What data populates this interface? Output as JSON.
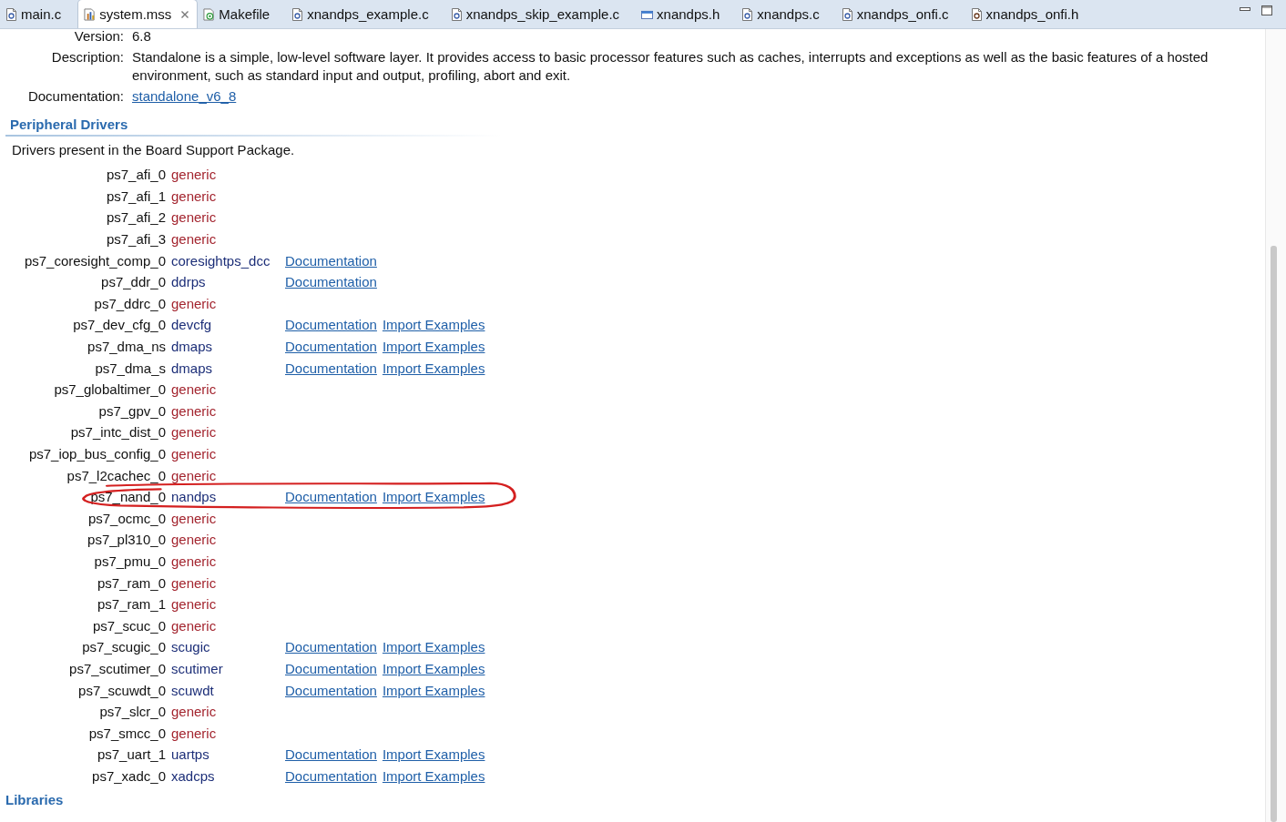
{
  "tabs": [
    {
      "label": "main.c",
      "kind": "c",
      "selected": false,
      "closable": false
    },
    {
      "label": "system.mss",
      "kind": "mss",
      "selected": true,
      "closable": true
    },
    {
      "label": "Makefile",
      "kind": "make",
      "selected": false,
      "closable": false
    },
    {
      "label": "xnandps_example.c",
      "kind": "c",
      "selected": false,
      "closable": false
    },
    {
      "label": "xnandps_skip_example.c",
      "kind": "c",
      "selected": false,
      "closable": false
    },
    {
      "label": "xnandps.h",
      "kind": "window",
      "selected": false,
      "closable": false
    },
    {
      "label": "xnandps.c",
      "kind": "c",
      "selected": false,
      "closable": false
    },
    {
      "label": "xnandps_onfi.c",
      "kind": "c",
      "selected": false,
      "closable": false
    },
    {
      "label": "xnandps_onfi.h",
      "kind": "h",
      "selected": false,
      "closable": false
    }
  ],
  "os_info": [
    {
      "label": "Version:",
      "value": "6.8",
      "kind": "text"
    },
    {
      "label": "Description:",
      "value": "Standalone is a simple, low-level software layer. It provides access to basic processor features such as caches, interrupts and exceptions as well as the basic features of a hosted environment, such as standard input and output, profiling, abort and exit.",
      "kind": "text"
    },
    {
      "label": "Documentation:",
      "value": "standalone_v6_8",
      "kind": "link"
    }
  ],
  "peripheral_drivers": {
    "title": "Peripheral Drivers",
    "description": "Drivers present in the Board Support Package.",
    "rows": [
      {
        "instance": "ps7_afi_0",
        "driver": "generic",
        "kind": "generic",
        "links": [],
        "highlighted": false
      },
      {
        "instance": "ps7_afi_1",
        "driver": "generic",
        "kind": "generic",
        "links": [],
        "highlighted": false
      },
      {
        "instance": "ps7_afi_2",
        "driver": "generic",
        "kind": "generic",
        "links": [],
        "highlighted": false
      },
      {
        "instance": "ps7_afi_3",
        "driver": "generic",
        "kind": "generic",
        "links": [],
        "highlighted": false
      },
      {
        "instance": "ps7_coresight_comp_0",
        "driver": "coresightps_dcc",
        "kind": "driver",
        "links": [
          "Documentation"
        ],
        "highlighted": false
      },
      {
        "instance": "ps7_ddr_0",
        "driver": "ddrps",
        "kind": "driver",
        "links": [
          "Documentation"
        ],
        "highlighted": false
      },
      {
        "instance": "ps7_ddrc_0",
        "driver": "generic",
        "kind": "generic",
        "links": [],
        "highlighted": false
      },
      {
        "instance": "ps7_dev_cfg_0",
        "driver": "devcfg",
        "kind": "driver",
        "links": [
          "Documentation",
          "Import Examples"
        ],
        "highlighted": false
      },
      {
        "instance": "ps7_dma_ns",
        "driver": "dmaps",
        "kind": "driver",
        "links": [
          "Documentation",
          "Import Examples"
        ],
        "highlighted": false
      },
      {
        "instance": "ps7_dma_s",
        "driver": "dmaps",
        "kind": "driver",
        "links": [
          "Documentation",
          "Import Examples"
        ],
        "highlighted": false
      },
      {
        "instance": "ps7_globaltimer_0",
        "driver": "generic",
        "kind": "generic",
        "links": [],
        "highlighted": false
      },
      {
        "instance": "ps7_gpv_0",
        "driver": "generic",
        "kind": "generic",
        "links": [],
        "highlighted": false
      },
      {
        "instance": "ps7_intc_dist_0",
        "driver": "generic",
        "kind": "generic",
        "links": [],
        "highlighted": false
      },
      {
        "instance": "ps7_iop_bus_config_0",
        "driver": "generic",
        "kind": "generic",
        "links": [],
        "highlighted": false
      },
      {
        "instance": "ps7_l2cachec_0",
        "driver": "generic",
        "kind": "generic",
        "links": [],
        "highlighted": false
      },
      {
        "instance": "ps7_nand_0",
        "driver": "nandps",
        "kind": "driver",
        "links": [
          "Documentation",
          "Import Examples"
        ],
        "highlighted": true
      },
      {
        "instance": "ps7_ocmc_0",
        "driver": "generic",
        "kind": "generic",
        "links": [],
        "highlighted": false
      },
      {
        "instance": "ps7_pl310_0",
        "driver": "generic",
        "kind": "generic",
        "links": [],
        "highlighted": false
      },
      {
        "instance": "ps7_pmu_0",
        "driver": "generic",
        "kind": "generic",
        "links": [],
        "highlighted": false
      },
      {
        "instance": "ps7_ram_0",
        "driver": "generic",
        "kind": "generic",
        "links": [],
        "highlighted": false
      },
      {
        "instance": "ps7_ram_1",
        "driver": "generic",
        "kind": "generic",
        "links": [],
        "highlighted": false
      },
      {
        "instance": "ps7_scuc_0",
        "driver": "generic",
        "kind": "generic",
        "links": [],
        "highlighted": false
      },
      {
        "instance": "ps7_scugic_0",
        "driver": "scugic",
        "kind": "driver",
        "links": [
          "Documentation",
          "Import Examples"
        ],
        "highlighted": false
      },
      {
        "instance": "ps7_scutimer_0",
        "driver": "scutimer",
        "kind": "driver",
        "links": [
          "Documentation",
          "Import Examples"
        ],
        "highlighted": false
      },
      {
        "instance": "ps7_scuwdt_0",
        "driver": "scuwdt",
        "kind": "driver",
        "links": [
          "Documentation",
          "Import Examples"
        ],
        "highlighted": false
      },
      {
        "instance": "ps7_slcr_0",
        "driver": "generic",
        "kind": "generic",
        "links": [],
        "highlighted": false
      },
      {
        "instance": "ps7_smcc_0",
        "driver": "generic",
        "kind": "generic",
        "links": [],
        "highlighted": false
      },
      {
        "instance": "ps7_uart_1",
        "driver": "uartps",
        "kind": "driver",
        "links": [
          "Documentation",
          "Import Examples"
        ],
        "highlighted": false
      },
      {
        "instance": "ps7_xadc_0",
        "driver": "xadcps",
        "kind": "driver",
        "links": [
          "Documentation",
          "Import Examples"
        ],
        "highlighted": false
      }
    ]
  },
  "libraries": {
    "title": "Libraries"
  }
}
